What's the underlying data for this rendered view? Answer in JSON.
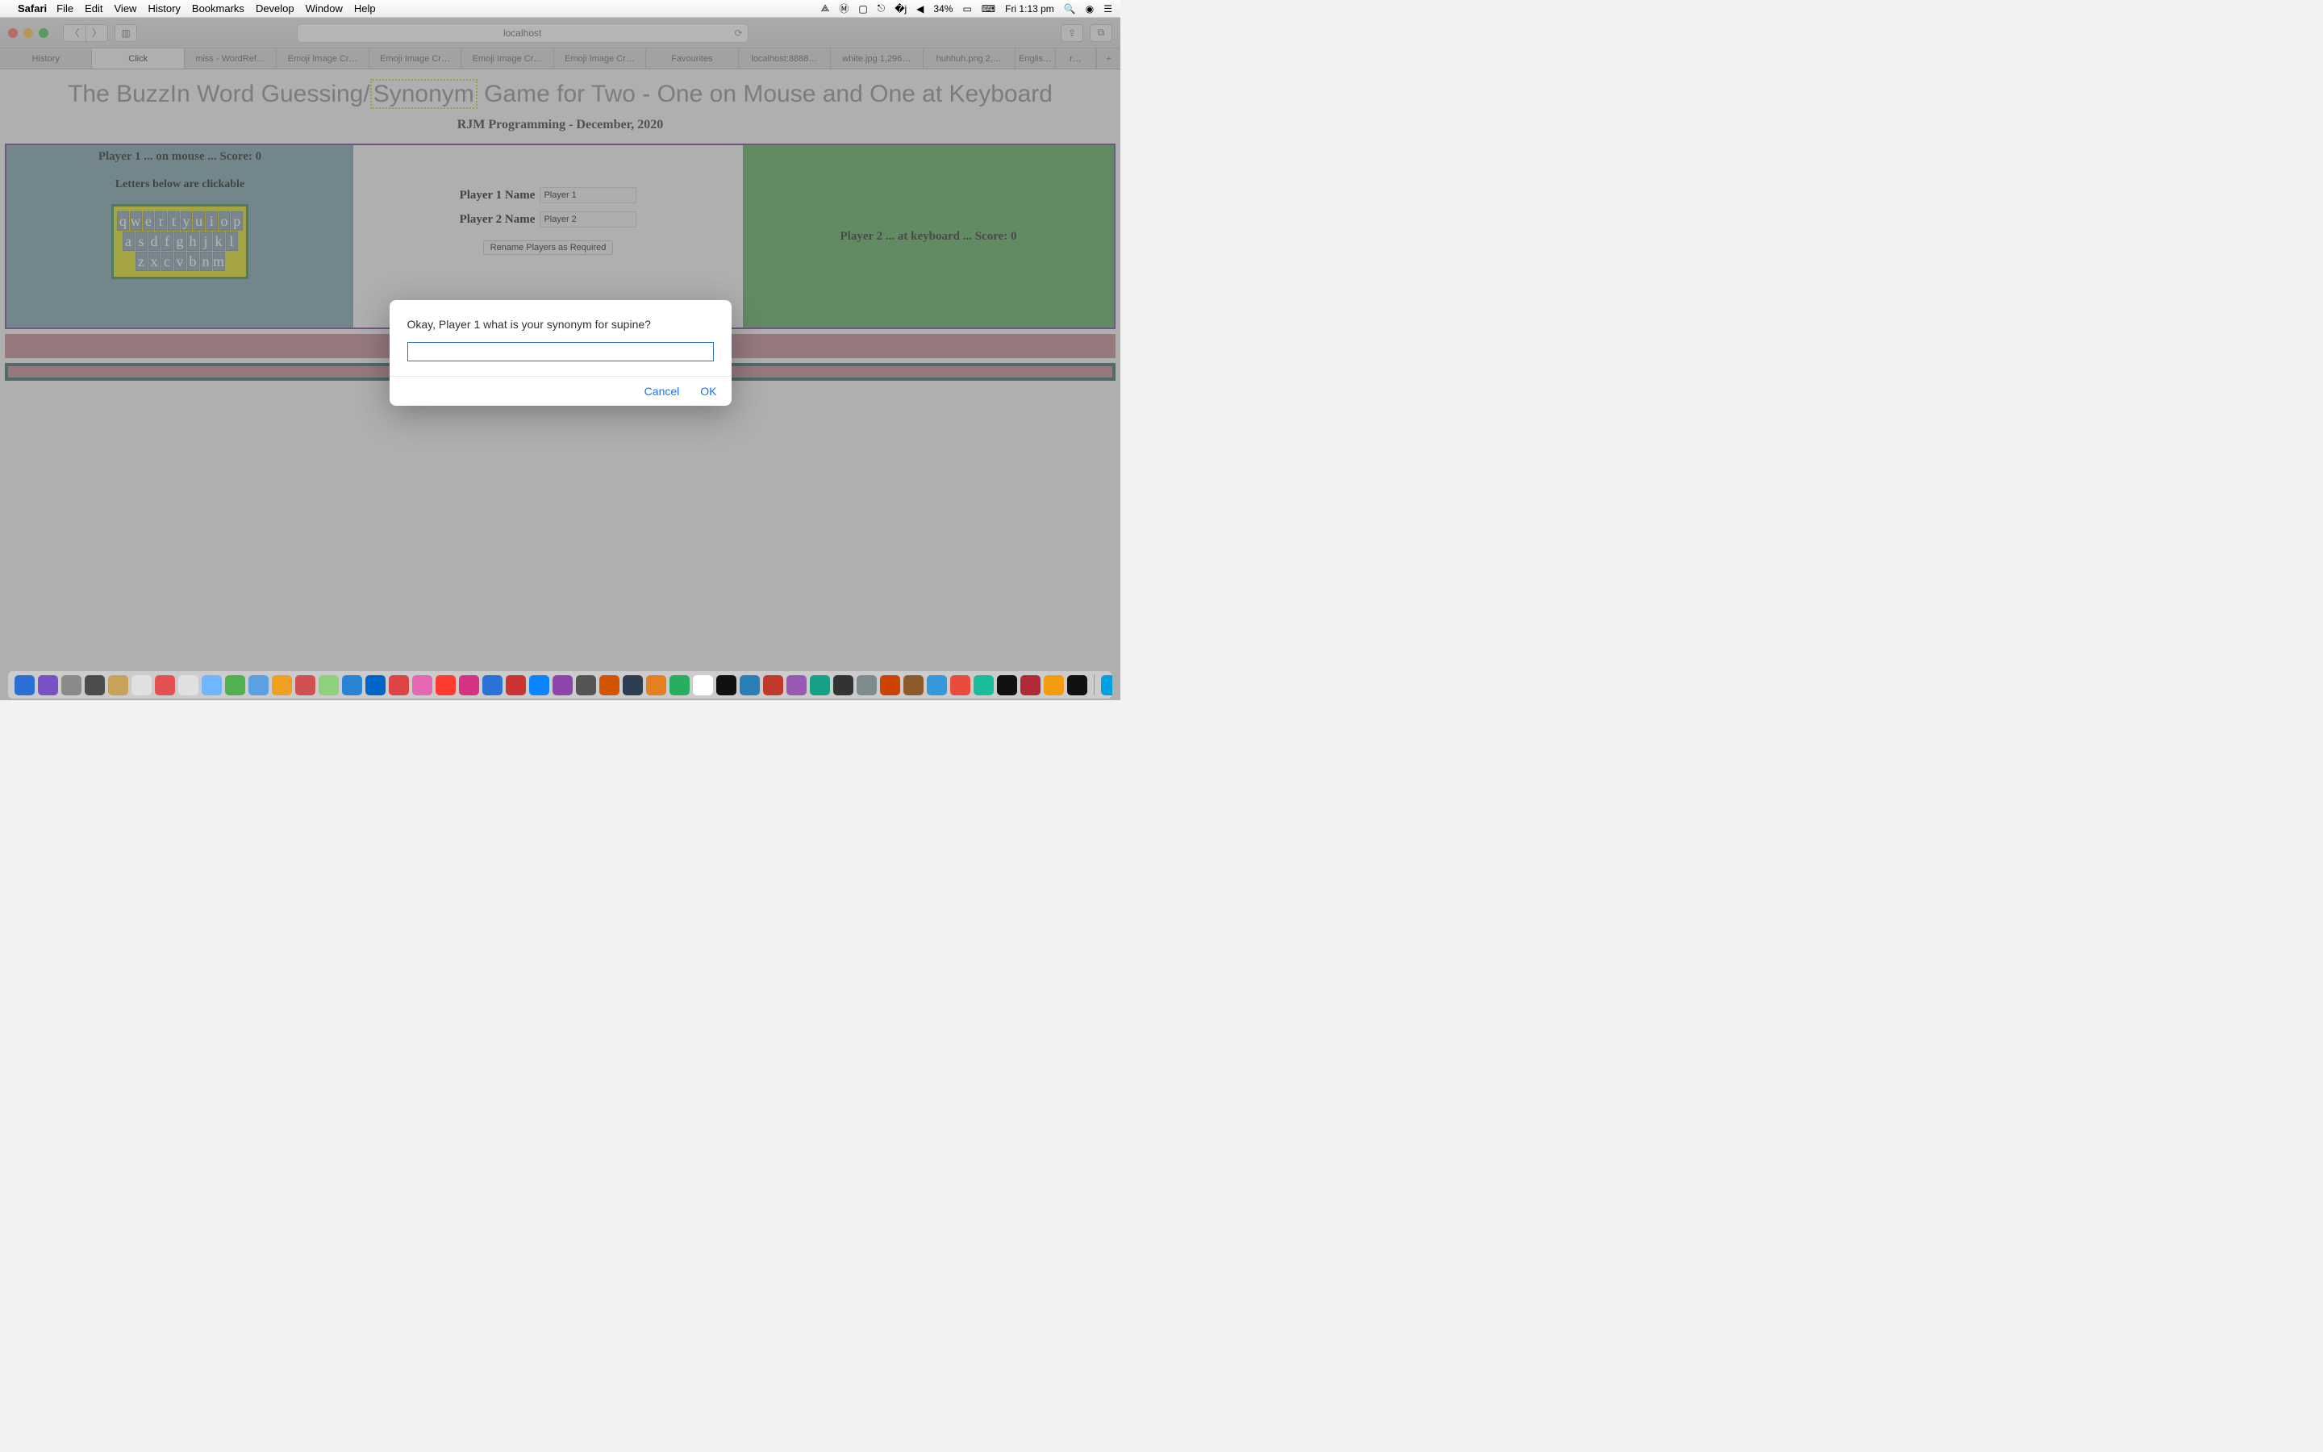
{
  "menubar": {
    "app": "Safari",
    "items": [
      "File",
      "Edit",
      "View",
      "History",
      "Bookmarks",
      "Develop",
      "Window",
      "Help"
    ],
    "battery": "34%",
    "clock": "Fri 1:13 pm"
  },
  "toolbar": {
    "url": "localhost"
  },
  "tabs": [
    "History",
    "Click",
    "miss - WordRef…",
    "Emoji Image Cr…",
    "Emoji Image Cr…",
    "Emoji Image Cr…",
    "Emoji Image Cr…",
    "Favourites",
    "localhost:8888…",
    "white.jpg 1,296…",
    "huhhuh.png 2,…",
    "Englis…",
    "r…"
  ],
  "page": {
    "title_pre": "The BuzzIn Word Guessing/",
    "title_syn": "Synonym",
    "title_post": " Game for Two - One on Mouse and One at Keyboard",
    "subtitle": "RJM Programming - December, 2020",
    "p1": "Player 1 ... on mouse ... Score: 0",
    "hint": "Letters below are clickable",
    "kbd": [
      [
        "q",
        "w",
        "e",
        "r",
        "t",
        "y",
        "u",
        "i",
        "o",
        "p"
      ],
      [
        "a",
        "s",
        "d",
        "f",
        "g",
        "h",
        "j",
        "k",
        "l"
      ],
      [
        "z",
        "x",
        "c",
        "v",
        "b",
        "n",
        "m"
      ]
    ],
    "p1name_l": "Player 1 Name",
    "p1name_v": "Player 1",
    "p2name_l": "Player 2 Name",
    "p2name_v": "Player 2",
    "rename": "Rename Players as Required",
    "p2": "Player 2 ... at keyboard ... Score: 0"
  },
  "dialog": {
    "message": "Okay, Player 1 what is your synonym for supine?",
    "cancel": "Cancel",
    "ok": "OK"
  },
  "dock_colors": [
    "#2b6fd6",
    "#7a52c7",
    "#8a8a8a",
    "#4c4c4c",
    "#c9a25a",
    "#e0e0e0",
    "#e35151",
    "#e0e0e0",
    "#6fb6ff",
    "#51b04f",
    "#5aa0e3",
    "#f0a020",
    "#d15050",
    "#8fd07d",
    "#2a84d6",
    "#0064c8",
    "#d44",
    "#e667b3",
    "#ff3b30",
    "#d63384",
    "#2a72d6",
    "#c33",
    "#0a84ff",
    "#8e44ad",
    "#555",
    "#d35400",
    "#2c3e50",
    "#e67e22",
    "#27ae60",
    "#fff",
    "#111",
    "#2980b9",
    "#c0392b",
    "#9b59b6",
    "#16a085",
    "#333",
    "#7f8c8d",
    "#c40",
    "#8c5a2b",
    "#3498db",
    "#e74c3c",
    "#1abc9c",
    "#111",
    "#b02a37",
    "#f39c12",
    "#111",
    "#00a1e0",
    "#b71c1c",
    "#222",
    "#666",
    "#3a78c2",
    "#666",
    "#666",
    "#666",
    "#666",
    "#2ecc71",
    "#95a5a6",
    "#bdc3c7"
  ]
}
